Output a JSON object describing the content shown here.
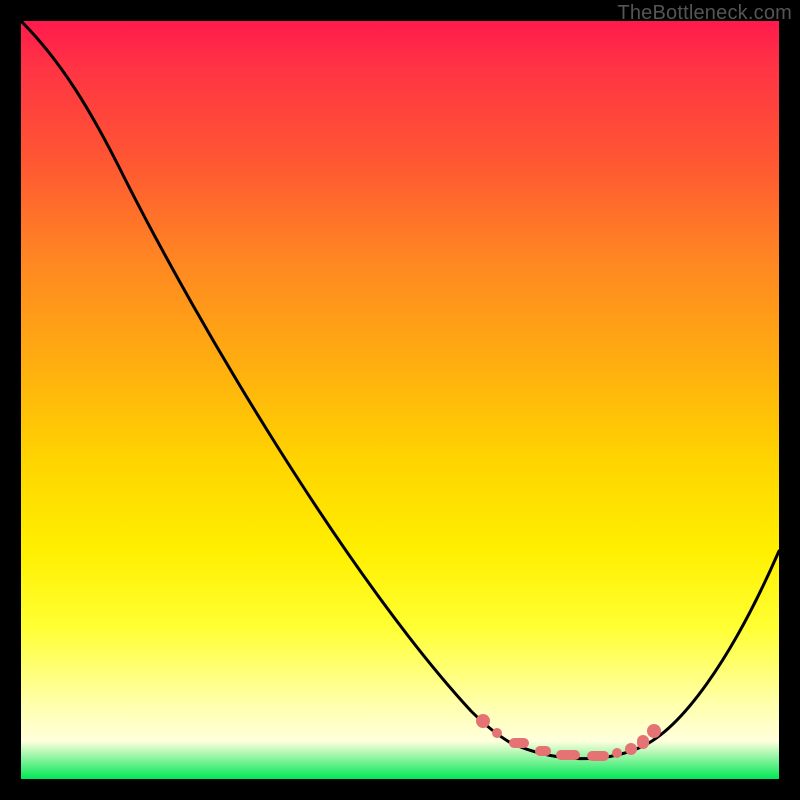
{
  "watermark": "TheBottleneck.com",
  "chart_data": {
    "type": "line",
    "title": "",
    "xlabel": "",
    "ylabel": "",
    "xlim": [
      0,
      100
    ],
    "ylim": [
      0,
      100
    ],
    "series": [
      {
        "name": "bottleneck-curve",
        "x": [
          0,
          6,
          12,
          20,
          30,
          40,
          50,
          58,
          64,
          68,
          72,
          76,
          80,
          84,
          88,
          92,
          96,
          100
        ],
        "values": [
          100,
          94,
          86,
          76,
          62,
          48,
          34,
          23,
          14,
          9,
          5,
          3,
          2,
          3,
          6,
          12,
          21,
          33
        ]
      }
    ],
    "highlight_region": {
      "name": "optimal-zone-dots",
      "x_start": 63,
      "x_end": 84,
      "style": "salmon-dashes"
    },
    "background_gradient": {
      "top": "#ff1a4d",
      "upper_mid": "#ff8822",
      "mid": "#ffd400",
      "lower_mid": "#ffff88",
      "bottom": "#00e756"
    },
    "colors": {
      "frame": "#000000",
      "curve": "#000000",
      "highlight": "#e57373",
      "watermark": "#555555"
    }
  }
}
